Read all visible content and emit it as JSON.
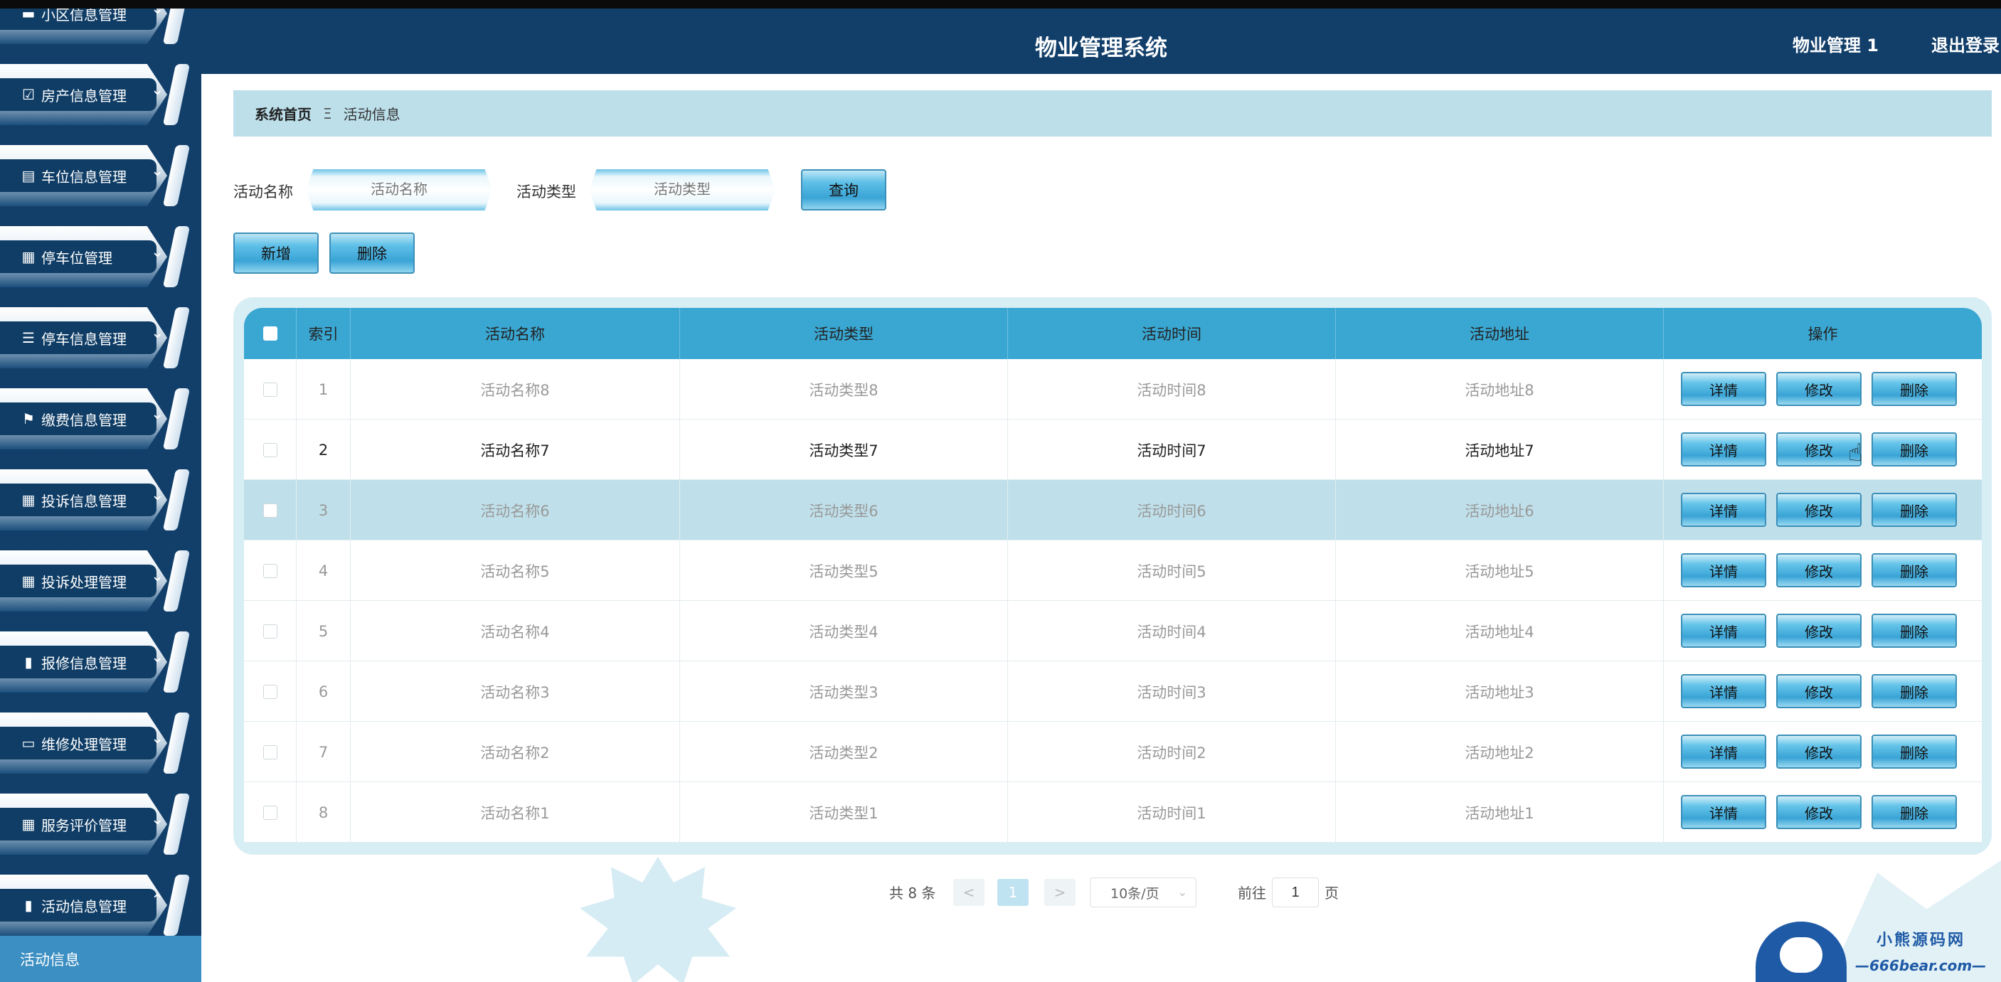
{
  "header": {
    "title": "物业管理系统",
    "user": "物业管理 1",
    "logout": "退出登录"
  },
  "sidebar": {
    "items": [
      {
        "label": "小区信息管理",
        "icon": "monitor-icon"
      },
      {
        "label": "房产信息管理",
        "icon": "checkbox-icon"
      },
      {
        "label": "车位信息管理",
        "icon": "clipboard-icon"
      },
      {
        "label": "停车位管理",
        "icon": "grid-icon"
      },
      {
        "label": "停车信息管理",
        "icon": "list-icon"
      },
      {
        "label": "缴费信息管理",
        "icon": "flag-icon"
      },
      {
        "label": "投诉信息管理",
        "icon": "grid-icon"
      },
      {
        "label": "投诉处理管理",
        "icon": "grid-icon"
      },
      {
        "label": "报修信息管理",
        "icon": "book-icon"
      },
      {
        "label": "维修处理管理",
        "icon": "chat-icon"
      },
      {
        "label": "服务评价管理",
        "icon": "grid-icon"
      },
      {
        "label": "活动信息管理",
        "icon": "bar-chart-icon"
      }
    ],
    "submenu_active": "活动信息"
  },
  "breadcrumb": {
    "home": "系统首页",
    "separator": "Ξ",
    "current": "活动信息"
  },
  "search": {
    "name_label": "活动名称",
    "name_placeholder": "活动名称",
    "type_label": "活动类型",
    "type_placeholder": "活动类型",
    "query_button": "查询"
  },
  "actions": {
    "add": "新增",
    "delete": "删除"
  },
  "table": {
    "columns": [
      "索引",
      "活动名称",
      "活动类型",
      "活动时间",
      "活动地址",
      "操作"
    ],
    "rows": [
      {
        "index": "1",
        "name": "活动名称8",
        "type": "活动类型8",
        "time": "活动时间8",
        "address": "活动地址8"
      },
      {
        "index": "2",
        "name": "活动名称7",
        "type": "活动类型7",
        "time": "活动时间7",
        "address": "活动地址7"
      },
      {
        "index": "3",
        "name": "活动名称6",
        "type": "活动类型6",
        "time": "活动时间6",
        "address": "活动地址6"
      },
      {
        "index": "4",
        "name": "活动名称5",
        "type": "活动类型5",
        "time": "活动时间5",
        "address": "活动地址5"
      },
      {
        "index": "5",
        "name": "活动名称4",
        "type": "活动类型4",
        "time": "活动时间4",
        "address": "活动地址4"
      },
      {
        "index": "6",
        "name": "活动名称3",
        "type": "活动类型3",
        "time": "活动时间3",
        "address": "活动地址3"
      },
      {
        "index": "7",
        "name": "活动名称2",
        "type": "活动类型2",
        "time": "活动时间2",
        "address": "活动地址2"
      },
      {
        "index": "8",
        "name": "活动名称1",
        "type": "活动类型1",
        "time": "活动时间1",
        "address": "活动地址1"
      }
    ],
    "row_buttons": {
      "detail": "详情",
      "edit": "修改",
      "delete": "删除"
    }
  },
  "pagination": {
    "total": "共 8 条",
    "prev": "<",
    "current_page": "1",
    "next": ">",
    "page_size": "10条/页",
    "goto_label": "前往",
    "goto_value": "1",
    "page_unit": "页"
  },
  "watermark": {
    "title": "小熊源码网",
    "site": "—666bear.com—"
  },
  "colors": {
    "sidebar_bg": "#123f6a",
    "header_bg": "#123f6a",
    "accent": "#3aa7d2",
    "highlight_row": "#bfe0ea"
  }
}
